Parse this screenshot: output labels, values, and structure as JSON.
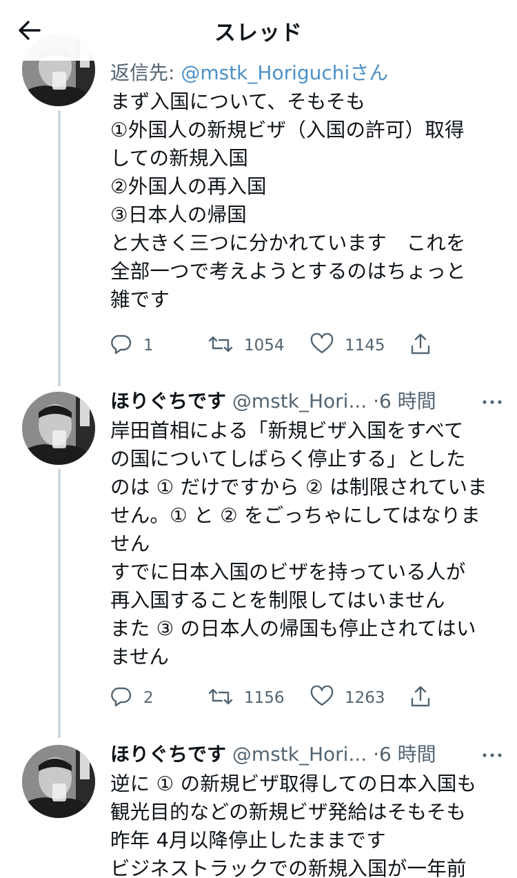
{
  "header": {
    "title": "スレッド"
  },
  "tweets": [
    {
      "reply_prefix": "返信先: ",
      "reply_mention": "@mstk_Horiguchi",
      "reply_suffix": "さん",
      "text": "まず入国について、そもそも\n①外国人の新規ビザ（入国の許可）取得\nしての新規入国\n②外国人の再入国\n③日本人の帰国\nと大きく三つに分かれています　これを\n全部一つで考えようとするのはちょっと\n雑です",
      "replies": "1",
      "retweets": "1054",
      "likes": "1145"
    },
    {
      "name": "ほりぐちです",
      "handle": "@mstk_Hori...",
      "time": "·6 時間",
      "text": "岸田首相による「新規ビザ入国をすべて\nの国についてしばらく停止する」とした\nのは ① だけですから ② は制限されていま\nせん。① と ② をごっちゃにしてはなりま\nせん\nすでに日本入国のビザを持っている人が\n再入国することを制限してはいません\nまた ③ の日本人の帰国も停止されてはい\nません",
      "replies": "2",
      "retweets": "1156",
      "likes": "1263"
    },
    {
      "name": "ほりぐちです",
      "handle": "@mstk_Hori...",
      "time": "·6 時間",
      "text": "逆に ① の新規ビザ取得しての日本入国も\n観光目的などの新規ビザ発給はそもそも\n昨年 4月以降停止したままです\nビジネストラックでの新規入国が一年前"
    }
  ],
  "icons": {
    "back": "arrow-left-icon",
    "reply": "reply-icon",
    "retweet": "retweet-icon",
    "like": "heart-icon",
    "share": "share-icon",
    "more": "more-icon"
  },
  "colors": {
    "text": "#0f1419",
    "secondary": "#536471",
    "mention": "#4a90c8",
    "thread_line": "#cfd9de"
  }
}
